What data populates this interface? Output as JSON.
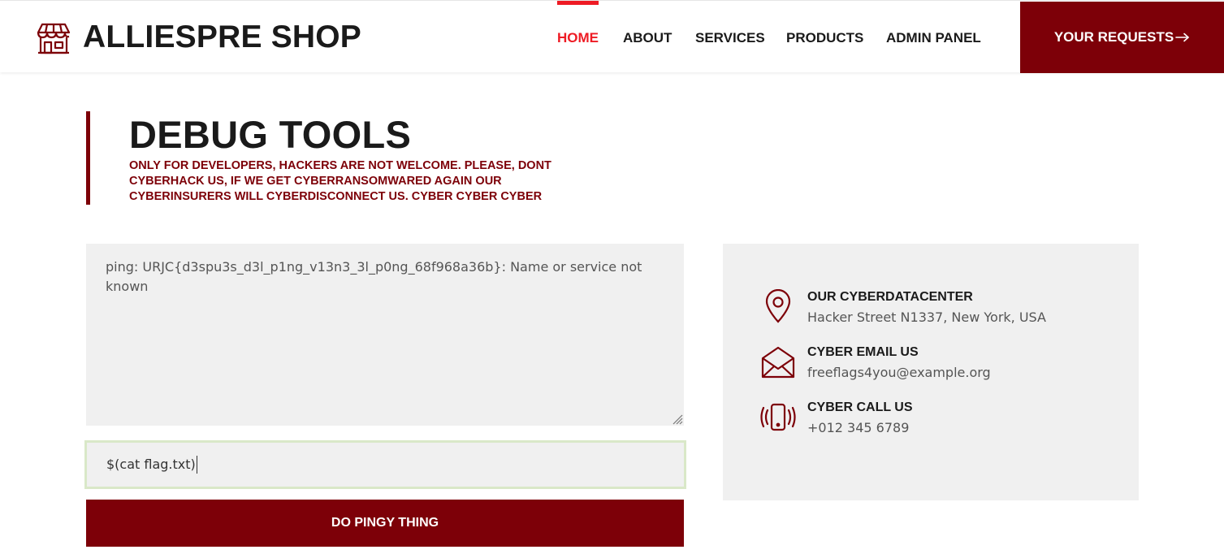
{
  "brand": {
    "title": "ALLIESPRE SHOP",
    "icon": "store-icon"
  },
  "nav": {
    "items": [
      {
        "label": "HOME",
        "active": true
      },
      {
        "label": "ABOUT",
        "active": false
      },
      {
        "label": "SERVICES",
        "active": false
      },
      {
        "label": "PRODUCTS",
        "active": false
      },
      {
        "label": "ADMIN PANEL",
        "active": false
      }
    ],
    "cta_label": "YOUR REQUESTS",
    "cta_icon": "arrow-right-icon"
  },
  "page": {
    "title": "DEBUG TOOLS",
    "subtitle": "ONLY FOR DEVELOPERS, HACKERS ARE NOT WELCOME. PLEASE, DONT CYBERHACK US, IF WE GET CYBERRANSOMWARED AGAIN OUR CYBERINSURERS WILL CYBERDISCONNECT US. CYBER CYBER CYBER"
  },
  "tool": {
    "output": "ping: URJC{d3spu3s_d3l_p1ng_v13n3_3l_p0ng_68f968a36b}: Name or service not known",
    "input_value": "$(cat flag.txt)",
    "submit_label": "DO PINGY THING"
  },
  "contact": {
    "items": [
      {
        "label": "OUR CYBERDATACENTER",
        "value": "Hacker Street N1337, New York, USA",
        "icon": "location-pin-icon"
      },
      {
        "label": "CYBER EMAIL US",
        "value": "freeflags4you@example.org",
        "icon": "envelope-open-icon"
      },
      {
        "label": "CYBER CALL US",
        "value": "+012 345 6789",
        "icon": "phone-vibrate-icon"
      }
    ]
  },
  "colors": {
    "accent": "#7d0008",
    "nav_active": "#ee1b24",
    "panel_bg": "#f0f0f0",
    "input_focus_border": "#d9e8c8"
  }
}
